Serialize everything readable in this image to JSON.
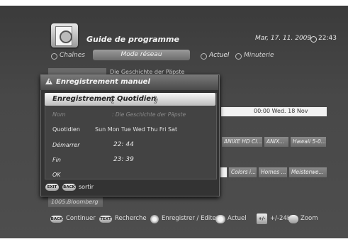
{
  "header": {
    "title": "Guide de programme",
    "date": "Mar, 17. 11. 2009",
    "time": "22:43"
  },
  "tabs": {
    "chaines": "Chaînes",
    "mode_reseau": "Mode réseau",
    "actuel": "Actuel",
    "minuterie": "Minuterie"
  },
  "background_guide": {
    "program_row0": "Die Geschichte der Päpste",
    "time_bar": "00:00 Wed. 18 Nov",
    "row1": [
      "ANIXE HD Cl...",
      "ANIX...",
      "Hawaii 5-0..."
    ],
    "row2": [
      "Colors i...",
      "Homes ...",
      "Meisterwe..."
    ],
    "channel_bloomberg": "1005.Bloomberg"
  },
  "dialog": {
    "title": "Enregistrement manuel",
    "selector": {
      "label": "Enregistrement",
      "value": "Quotidien",
      "arrow_left": "《",
      "arrow_right": "》"
    },
    "fields": {
      "nom_label": "Nom",
      "nom_value": ": Die Geschichte der Päpste",
      "quotidien_label": "Quotidien",
      "days": "Sun Mon Tue Wed Thu Fri Sat",
      "demarrer_label": "Démarrer",
      "demarrer_value": "22: 44",
      "fin_label": "Fin",
      "fin_value": "23: 39",
      "ok_label": "OK"
    },
    "footer": {
      "exit_btn": "EXIT",
      "back_btn": "BACK",
      "sortir": "sortir"
    }
  },
  "footer": {
    "back_btn": "BACK",
    "continuer": "Continuer",
    "text_btn": "TEXT",
    "recherche": "Recherche",
    "enregistrer": "Enregistrer / Editer",
    "actuel": "Actuel",
    "plus_minus_icon_text": "+/-",
    "plus_minus_24h": "+/-24H",
    "zoom": "Zoom"
  }
}
